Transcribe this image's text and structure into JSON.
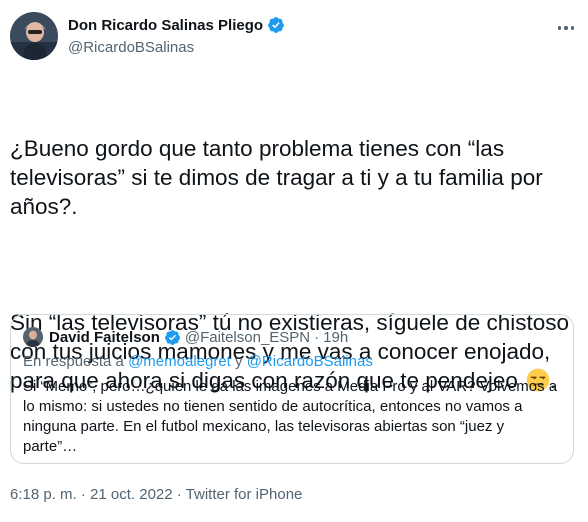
{
  "author": {
    "name": "Don Ricardo Salinas Pliego",
    "handle": "@RicardoBSalinas",
    "avatar": "avatar-photo",
    "verified_icon": "verified-badge-icon"
  },
  "tweet": {
    "paragraph1": "¿Bueno gordo que tanto problema tienes con “las televisoras” si te dimos de tragar a ti y a tu familia por años?.",
    "paragraph2": "Sin “las televisoras” tú no existieras, síguele de chistoso con tus juicios mamones y me vas a conocer enojado, para que ahora si digas con razón que te pendejeo",
    "emoji": "unamused-face-emoji"
  },
  "quoted_tweet": {
    "name": "David Faitelson",
    "handle": "@Faitelson_ESPN",
    "separator": "·",
    "time": "19h",
    "reply_prefix": "En respuesta a",
    "reply_mention_1": "@memoalegret",
    "reply_conjunction": "y",
    "reply_mention_2": "@RicardoBSalinas",
    "text": "Si “Memo”, pero…¿quien le da las imagenes a Media Pro y al VAR? Volvemos a lo mismo: si ustedes no tienen sentido de autocrítica, entonces no vamos a ninguna parte. En el futbol mexicano, las televisoras abiertas son “juez y parte”…"
  },
  "meta": {
    "text": "6:18 p. m. · 21 oct. 2022 · Twitter for iPhone"
  },
  "colors": {
    "verified": "#1d9bf0",
    "secondary_text": "#536471",
    "link": "#1d9bf0",
    "border": "#cfd9de"
  }
}
